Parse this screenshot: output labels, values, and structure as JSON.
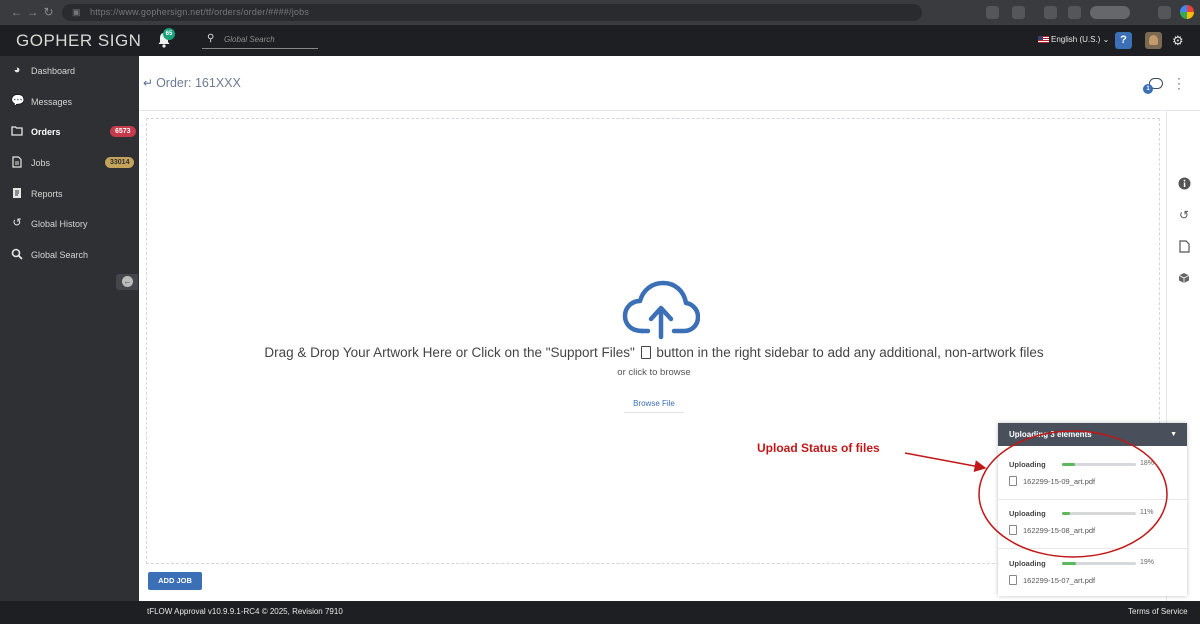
{
  "browser": {
    "url": "https://www.gophersign.net/tf/orders/order/####/jobs"
  },
  "header": {
    "brand": "GOPHER SIGN",
    "notification_count": "65",
    "search_placeholder": "Global Search",
    "language": "English (U.S.)",
    "help_label": "?"
  },
  "sidebar": {
    "items": [
      {
        "label": "Dashboard",
        "icon": "dashboard-icon"
      },
      {
        "label": "Messages",
        "icon": "messages-icon"
      },
      {
        "label": "Orders",
        "icon": "folder-icon",
        "count": "6573"
      },
      {
        "label": "Jobs",
        "icon": "file-icon",
        "count": "33014"
      },
      {
        "label": "Reports",
        "icon": "reports-icon"
      },
      {
        "label": "Global History",
        "icon": "history-icon"
      },
      {
        "label": "Global Search",
        "icon": "search-icon"
      }
    ]
  },
  "main": {
    "title": "Order: 161XXX",
    "chat_count": "1",
    "dropzone": {
      "message_part1": "Drag & Drop Your Artwork Here or Click on the \"Support Files\"",
      "message_part2": "button in the right sidebar to add any additional, non-artwork files",
      "sub": "or click to browse",
      "browse_label": "Browse File"
    },
    "add_job_label": "ADD JOB"
  },
  "upload_panel": {
    "title": "Uploading 3 elements",
    "items": [
      {
        "status": "Uploading",
        "percent": "18%",
        "progress": 0.18,
        "filename": "162299-15-09_art.pdf"
      },
      {
        "status": "Uploading",
        "percent": "11%",
        "progress": 0.11,
        "filename": "162299-15-08_art.pdf"
      },
      {
        "status": "Uploading",
        "percent": "19%",
        "progress": 0.19,
        "filename": "162299-15-07_art.pdf"
      }
    ]
  },
  "annotation": {
    "label": "Upload Status of files",
    "color": "#c01818"
  },
  "footer": {
    "version": "tFLOW Approval v10.9.9.1-RC4 © 2025, Revision 7910",
    "terms": "Terms of Service"
  },
  "colors": {
    "accent": "#3b6fb6",
    "sidebar_bg": "#2f3034",
    "header_bg": "#1e1f22",
    "orders_badge": "#c63a4b",
    "jobs_badge": "#c4a35a",
    "progress": "#5cb85c"
  }
}
